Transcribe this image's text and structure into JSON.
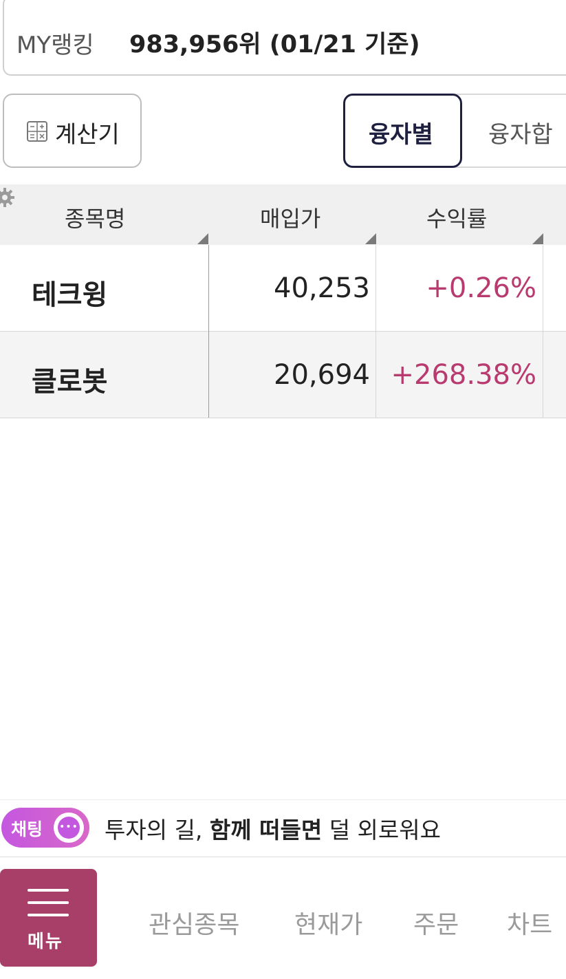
{
  "ranking": {
    "label": "MY랭킹",
    "value": "983,956위 (01/21 기준)"
  },
  "toolbar": {
    "calculator_label": "계산기",
    "segments": [
      {
        "label": "융자별",
        "active": true
      },
      {
        "label": "융자합",
        "active": false
      }
    ]
  },
  "table": {
    "columns": [
      "종목명",
      "매입가",
      "수익률"
    ],
    "rows": [
      {
        "name": "테크윙",
        "purchase_price": "40,253",
        "return_rate": "+0.26%"
      },
      {
        "name": "클로봇",
        "purchase_price": "20,694",
        "return_rate": "+268.38%"
      }
    ],
    "return_color": "#b83a6e"
  },
  "chat": {
    "pill_label": "채팅",
    "message_part1": "투자의 길, ",
    "message_bold": "함께 떠들면",
    "message_part2": " 덜 외로워요"
  },
  "bottom_nav": {
    "menu_label": "메뉴",
    "items": [
      "관심종목",
      "현재가",
      "주문",
      "차트"
    ]
  },
  "colors": {
    "accent": "#a73f68",
    "positive": "#b83a6e",
    "chat_gradient": "#c457e0"
  }
}
